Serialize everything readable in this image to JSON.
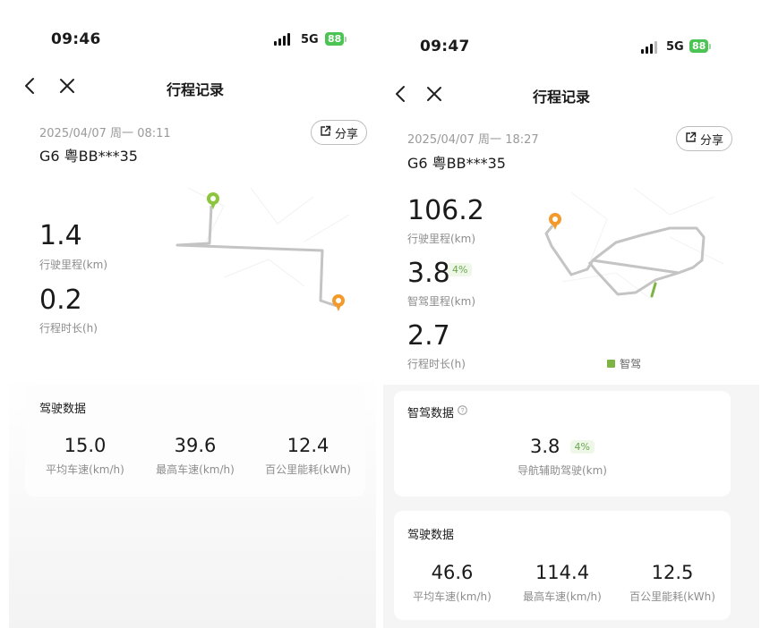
{
  "screen1": {
    "status": {
      "time": "09:46",
      "network": "5G",
      "battery": "88"
    },
    "nav": {
      "title": "行程记录"
    },
    "trip": {
      "datetime": "2025/04/07 周一 08:11",
      "plate": "G6 粤BB***35",
      "share_label": "分享"
    },
    "stats": [
      {
        "value": "1.4",
        "label": "行驶里程(km)"
      },
      {
        "value": "0.2",
        "label": "行程时长(h)"
      }
    ],
    "driving": {
      "title": "驾驶数据",
      "items": [
        {
          "value": "15.0",
          "label": "平均车速(km/h)"
        },
        {
          "value": "39.6",
          "label": "最高车速(km/h)"
        },
        {
          "value": "12.4",
          "label": "百公里能耗(kWh)"
        }
      ]
    }
  },
  "screen2": {
    "status": {
      "time": "09:47",
      "network": "5G",
      "battery": "88"
    },
    "nav": {
      "title": "行程记录"
    },
    "trip": {
      "datetime": "2025/04/07 周一 18:27",
      "plate": "G6 粤BB***35",
      "share_label": "分享"
    },
    "stats": [
      {
        "value": "106.2",
        "label": "行驶里程(km)"
      },
      {
        "value": "3.8",
        "label": "智驾里程(km)",
        "badge": "4%"
      },
      {
        "value": "2.7",
        "label": "行程时长(h)"
      }
    ],
    "legend": "智驾",
    "smart": {
      "title": "智驾数据",
      "value": "3.8",
      "badge": "4%",
      "label": "导航辅助驾驶(km)"
    },
    "driving": {
      "title": "驾驶数据",
      "items": [
        {
          "value": "46.6",
          "label": "平均车速(km/h)"
        },
        {
          "value": "114.4",
          "label": "最高车速(km/h)"
        },
        {
          "value": "12.5",
          "label": "百公里能耗(kWh)"
        }
      ]
    }
  },
  "colors": {
    "start_pin": "#8cc63f",
    "end_pin": "#f39a2b",
    "route": "#c4c4c4",
    "smart_route": "#7cb342",
    "badge_bg": "#eef7e8",
    "battery": "#4cc454"
  }
}
